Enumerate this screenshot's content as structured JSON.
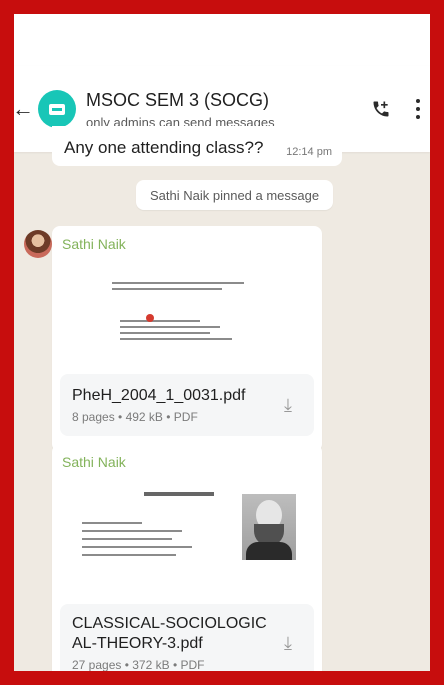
{
  "header": {
    "title": "MSOC SEM 3 (SOCG)",
    "subtitle": "only admins can send messages"
  },
  "messages": {
    "first": {
      "text": "Any one attending class??",
      "time": "12:14 pm"
    },
    "system_note": "Sathi Naik pinned a message",
    "doc1": {
      "sender": "Sathi Naik",
      "file_name": "PheH_2004_1_0031.pdf",
      "file_meta": "8 pages • 492 kB • PDF"
    },
    "doc2": {
      "sender": "Sathi Naik",
      "file_name_line1": "CLASSICAL-SOCIOLOGIC",
      "file_name_line2": "AL-THEORY-3.pdf",
      "file_meta": "27 pages • 372 kB • PDF"
    }
  },
  "icons": {
    "back": "back-arrow-icon",
    "add_call": "phone-add-icon",
    "more": "more-vertical-icon",
    "download": "download-icon"
  },
  "colors": {
    "frame_red": "#c70d0d",
    "chat_bg": "#efeae2",
    "avatar_teal": "#18c6b7",
    "sender_name": "#83b35b"
  }
}
